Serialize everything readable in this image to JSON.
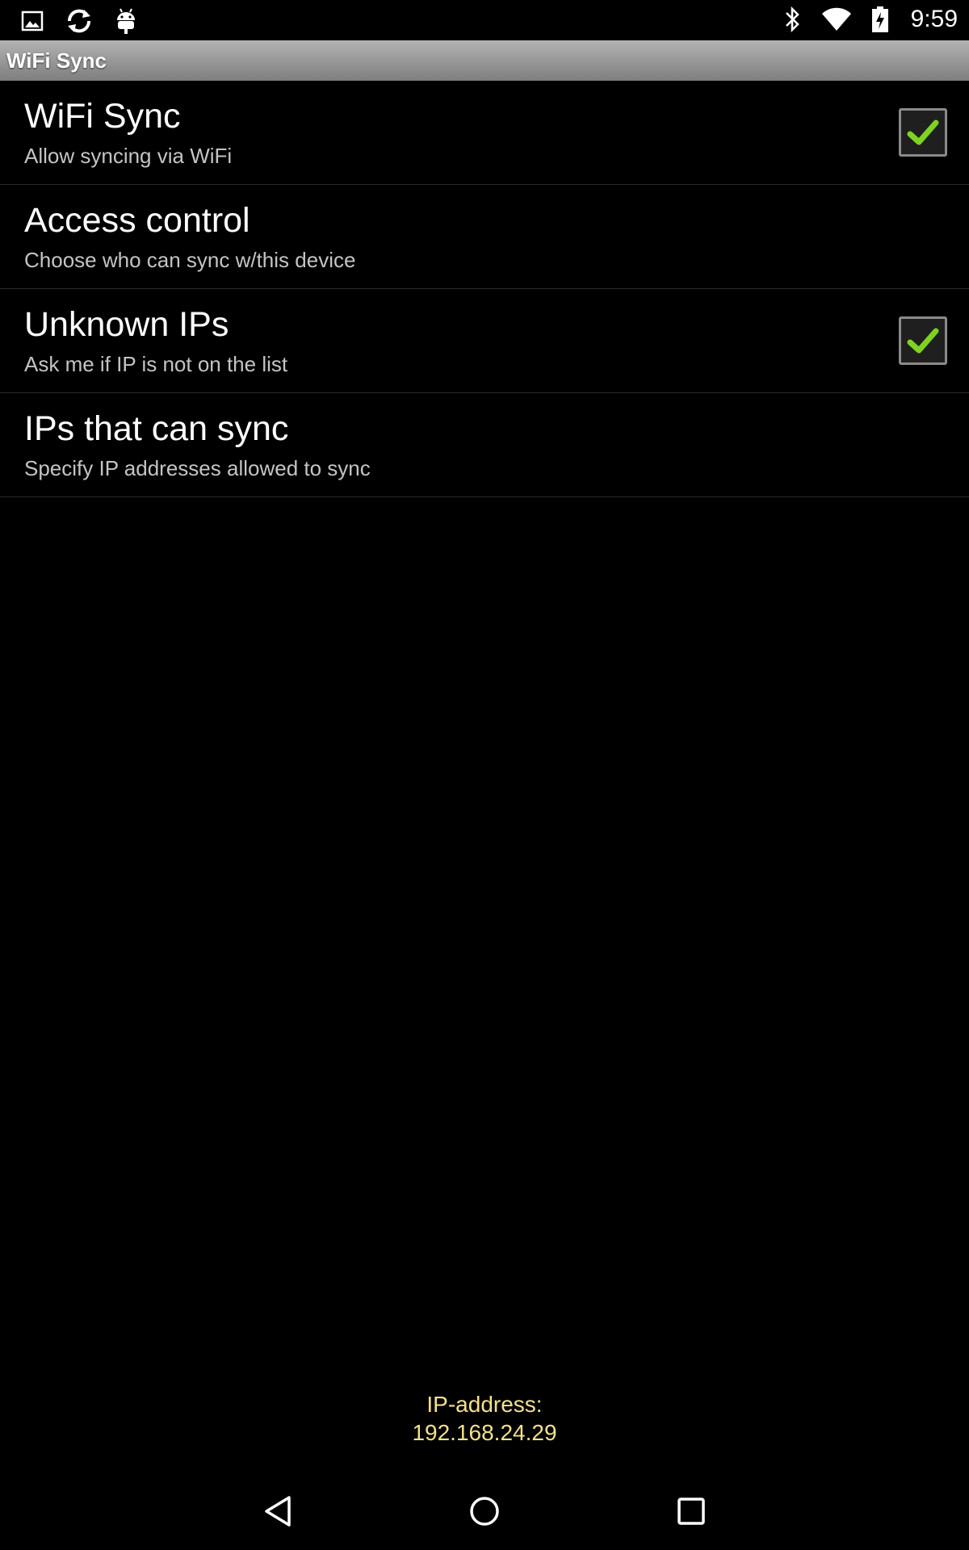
{
  "status_bar": {
    "left_icons": [
      "image-icon",
      "sync-icon",
      "android-icon"
    ],
    "right_icons": [
      "bluetooth-icon",
      "wifi-signal-icon",
      "battery-charging-icon"
    ],
    "time": "9:59"
  },
  "app": {
    "title": "WiFi Sync"
  },
  "preferences": [
    {
      "title": "WiFi Sync",
      "summary": "Allow syncing via WiFi",
      "checked": true
    },
    {
      "title": "Access control",
      "summary": "Choose who can sync w/this device",
      "checked": null
    },
    {
      "title": "Unknown IPs",
      "summary": "Ask me if IP is not on the list",
      "checked": true
    },
    {
      "title": "IPs that can sync",
      "summary": "Specify IP addresses allowed to sync",
      "checked": null
    }
  ],
  "footer": {
    "ip_label": "IP-address:",
    "ip_value": "192.168.24.29"
  },
  "nav_bar": {
    "buttons": [
      "back-icon",
      "home-icon",
      "recents-icon"
    ]
  },
  "colors": {
    "background": "#000000",
    "check_green": "#7ed321",
    "ip_text": "#f3e08a",
    "title_bar": "#9a9a9a"
  }
}
